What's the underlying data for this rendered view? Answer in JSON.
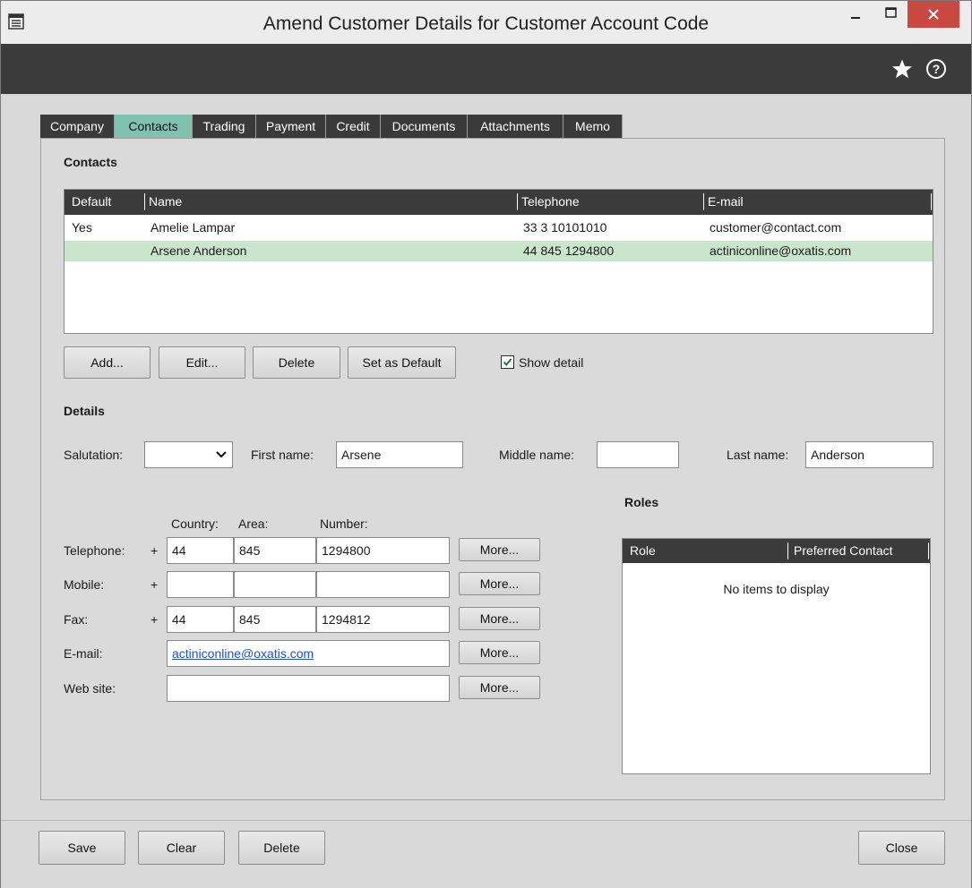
{
  "window": {
    "title": "Amend Customer Details for Customer Account Code",
    "icons": {
      "app": "form-icon",
      "minimize": "minimize-icon",
      "maximize": "maximize-icon",
      "close": "close-icon"
    }
  },
  "toolbar": {
    "favourite_icon": "star-icon",
    "help_icon": "help-icon"
  },
  "tabs": [
    {
      "label": "Company"
    },
    {
      "label": "Contacts"
    },
    {
      "label": "Trading"
    },
    {
      "label": "Payment"
    },
    {
      "label": "Credit"
    },
    {
      "label": "Documents"
    },
    {
      "label": "Attachments"
    },
    {
      "label": "Memo"
    }
  ],
  "active_tab": "Contacts",
  "contacts": {
    "section_title": "Contacts",
    "columns": {
      "default": "Default",
      "name": "Name",
      "telephone": "Telephone",
      "email": "E-mail"
    },
    "rows": [
      {
        "default": "Yes",
        "name": "Amelie Lampar",
        "telephone": "33 3 10101010",
        "email": "customer@contact.com"
      },
      {
        "default": "",
        "name": "Arsene Anderson",
        "telephone": "44 845 1294800",
        "email": "actiniconline@oxatis.com"
      }
    ],
    "selected_row": 1,
    "buttons": {
      "add": "Add...",
      "edit": "Edit...",
      "delete": "Delete",
      "set_default": "Set as Default"
    },
    "show_detail": {
      "label": "Show detail",
      "checked": true
    }
  },
  "details": {
    "section_title": "Details",
    "salutation": {
      "label": "Salutation:",
      "value": ""
    },
    "first_name": {
      "label": "First name:",
      "value": "Arsene"
    },
    "middle_name": {
      "label": "Middle name:",
      "value": ""
    },
    "last_name": {
      "label": "Last name:",
      "value": "Anderson"
    },
    "phone_headers": {
      "country": "Country:",
      "area": "Area:",
      "number": "Number:"
    },
    "plus": "+",
    "telephone": {
      "label": "Telephone:",
      "country": "44",
      "area": "845",
      "number": "1294800"
    },
    "mobile": {
      "label": "Mobile:",
      "country": "",
      "area": "",
      "number": ""
    },
    "fax": {
      "label": "Fax:",
      "country": "44",
      "area": "845",
      "number": "1294812"
    },
    "email": {
      "label": "E-mail:",
      "value": "actiniconline@oxatis.com"
    },
    "website": {
      "label": "Web site:",
      "value": ""
    },
    "more_label": "More..."
  },
  "roles": {
    "section_title": "Roles",
    "columns": {
      "role": "Role",
      "preferred": "Preferred Contact"
    },
    "empty_text": "No items to display"
  },
  "footer": {
    "save": "Save",
    "clear": "Clear",
    "delete": "Delete",
    "close": "Close"
  }
}
